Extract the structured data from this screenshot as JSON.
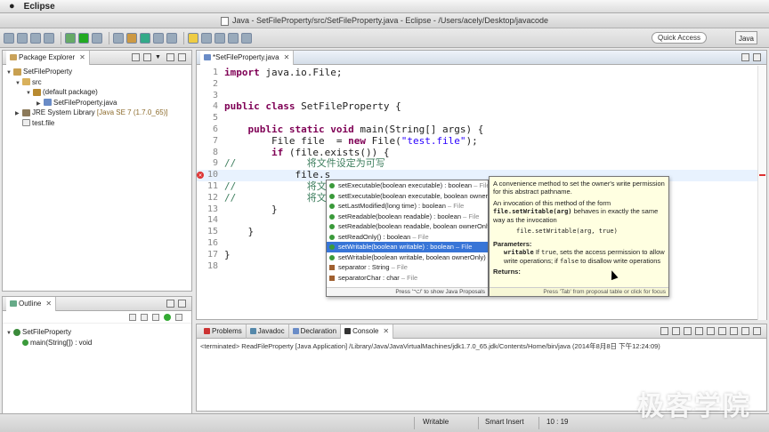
{
  "menubar": {
    "app_name": "Eclipse"
  },
  "window": {
    "title": "Java - SetFileProperty/src/SetFileProperty.java - Eclipse - /Users/acely/Desktop/javacode"
  },
  "toolbar": {
    "quick_access": "Quick Access",
    "perspective": "Java"
  },
  "package_explorer": {
    "tab": "Package Explorer",
    "items": [
      {
        "label": "SetFileProperty"
      },
      {
        "label": "src"
      },
      {
        "label": "(default package)"
      },
      {
        "label": "SetFileProperty.java"
      },
      {
        "label": "JRE System Library",
        "suffix": "[Java SE 7 (1.7.0_65)]"
      },
      {
        "label": "test.file"
      }
    ]
  },
  "outline": {
    "tab": "Outline",
    "items": [
      {
        "label": "SetFileProperty"
      },
      {
        "label": "main(String[]) : void"
      }
    ]
  },
  "editor": {
    "tab": "*SetFileProperty.java",
    "lines": [
      {
        "n": "1",
        "text": "import java.io.File;"
      },
      {
        "n": "2",
        "text": ""
      },
      {
        "n": "3",
        "text": ""
      },
      {
        "n": "4",
        "text": "public class SetFileProperty {"
      },
      {
        "n": "5",
        "text": ""
      },
      {
        "n": "6",
        "text": "    public static void main(String[] args) {"
      },
      {
        "n": "7",
        "text": "        File file  = new File(\"test.file\");"
      },
      {
        "n": "8",
        "text": "        if (file.exists()) {"
      },
      {
        "n": "9",
        "text": "//            将文件设定为可写"
      },
      {
        "n": "10",
        "text": "            file.s"
      },
      {
        "n": "11",
        "text": "//            将文件"
      },
      {
        "n": "12",
        "text": "//            将文件"
      },
      {
        "n": "13",
        "text": "        }"
      },
      {
        "n": "14",
        "text": ""
      },
      {
        "n": "15",
        "text": "    }"
      },
      {
        "n": "16",
        "text": ""
      },
      {
        "n": "17",
        "text": "}"
      },
      {
        "n": "18",
        "text": ""
      }
    ]
  },
  "content_assist": {
    "items": [
      {
        "name": "setExecutable(boolean executable) : boolean",
        "owner": " – File",
        "kind": "method"
      },
      {
        "name": "setExecutable(boolean executable, boolean ownerOnly)",
        "owner": "",
        "kind": "method"
      },
      {
        "name": "setLastModified(long time) : boolean",
        "owner": " – File",
        "kind": "method"
      },
      {
        "name": "setReadable(boolean readable) : boolean",
        "owner": " – File",
        "kind": "method"
      },
      {
        "name": "setReadable(boolean readable, boolean ownerOnly)",
        "owner": "",
        "kind": "method"
      },
      {
        "name": "setReadOnly() : boolean",
        "owner": " – File",
        "kind": "method"
      },
      {
        "name": "setWritable(boolean writable) : boolean",
        "owner": " – File",
        "kind": "method"
      },
      {
        "name": "setWritable(boolean writable, boolean ownerOnly)",
        "owner": "",
        "kind": "method"
      },
      {
        "name": "separator : String",
        "owner": " – File",
        "kind": "field"
      },
      {
        "name": "separatorChar : char",
        "owner": " – File",
        "kind": "field"
      }
    ],
    "footer": "Press '⌥/' to show Java Proposals"
  },
  "javadoc": {
    "p1": "A convenience method to set the owner's write permission for this abstract pathname.",
    "p2_pre": "An invocation of this method of the form",
    "p2_code": "file.setWritable(arg)",
    "p2_post": "behaves in exactly the same way as the invocation",
    "code": "file.setWritable(arg, true)",
    "params_heading": "Parameters:",
    "param_name": "writable",
    "param_pre": "If",
    "param_true": "true",
    "param_mid": ", sets the access permission to allow write operations; if",
    "param_false": "false",
    "param_post": "to disallow write operations",
    "returns_heading": "Returns:",
    "footer": "Press 'Tab' from proposal table or click for focus"
  },
  "bottom_tabs": [
    "Problems",
    "Javadoc",
    "Declaration",
    "Console"
  ],
  "console": {
    "line": "<terminated> ReadFileProperty [Java Application] /Library/Java/JavaVirtualMachines/jdk1.7.0_65.jdk/Contents/Home/bin/java (2014年8月8日 下午12:24:09)"
  },
  "statusbar": {
    "mode1": "Writable",
    "mode2": "Smart Insert",
    "position": "10 : 19"
  },
  "watermark": "极客学院"
}
